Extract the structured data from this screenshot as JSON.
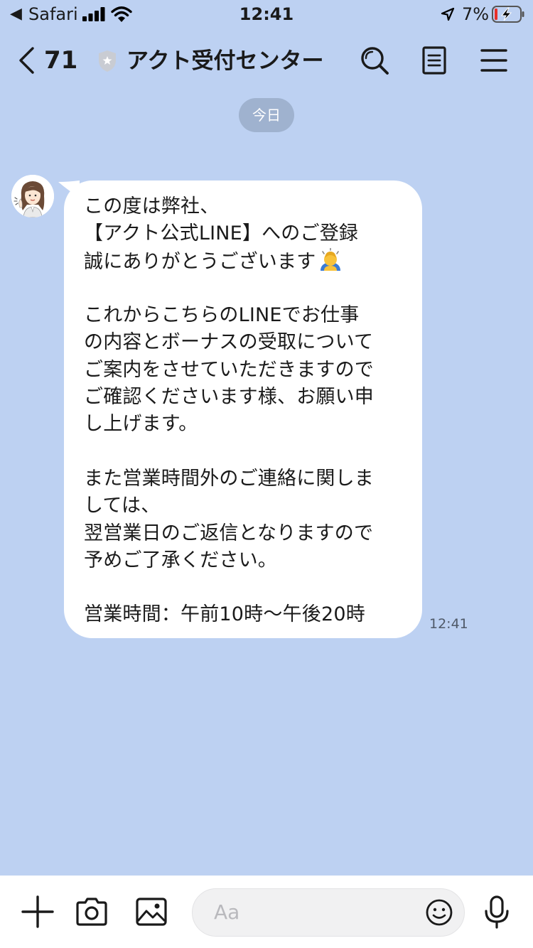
{
  "status_bar": {
    "back_glyph": "◀",
    "app": "Safari",
    "time": "12:41",
    "battery": "7%"
  },
  "header": {
    "back_count": "71",
    "title": "アクト受付センター",
    "icons": [
      "search-icon",
      "notes-icon",
      "menu-icon"
    ]
  },
  "date_separator": "今日",
  "message": {
    "sender_avatar": "avatar-woman",
    "lines": [
      "この度は弊社、",
      "【アクト公式LINE】へのご登録",
      "誠にありがとうございます",
      "",
      "これからこちらのLINEでお仕事",
      "の内容とボーナスの受取について",
      "ご案内をさせていただきますので",
      "ご確認くださいます様、お願い申",
      "し上げます。",
      "",
      "また営業時間外のご連絡に関しま",
      "しては、",
      "翌営業日のご返信となりますので",
      "予めご了承ください。",
      "",
      "営業時間：午前10時〜午後20時"
    ],
    "emoji": "bowing-person",
    "time": "12:41"
  },
  "input_bar": {
    "placeholder": "Aa",
    "icons": [
      "plus-icon",
      "camera-icon",
      "image-icon",
      "emoji-icon",
      "mic-icon"
    ]
  },
  "colors": {
    "chat_background": "#bdd1f2",
    "bubble": "#ffffff",
    "date_pill": "#9fb2cf"
  }
}
